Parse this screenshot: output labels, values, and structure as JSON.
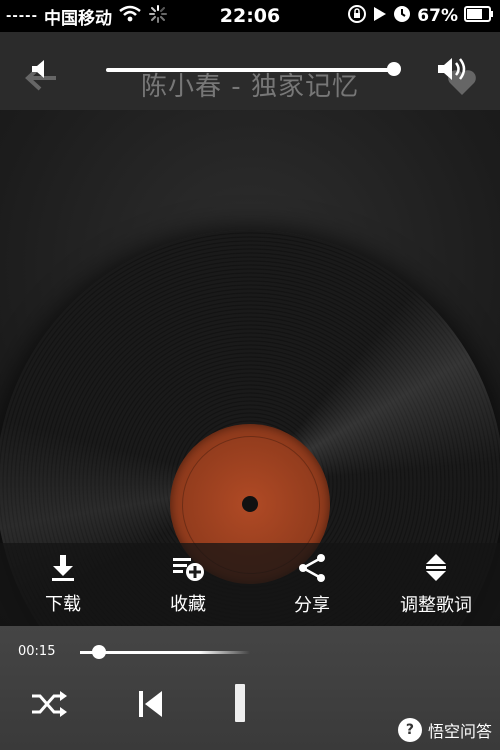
{
  "status_bar": {
    "signal": "-----",
    "carrier": "中国移动",
    "time": "22:06",
    "battery": "67%"
  },
  "player": {
    "song_title": "陈小春 - 独家记忆",
    "volume_fraction": 0.92,
    "elapsed": "00:15",
    "progress_fraction": 0.08
  },
  "actions": {
    "download": "下载",
    "favorite": "收藏",
    "share": "分享",
    "adjust_lyrics": "调整歌词"
  },
  "watermark": {
    "text": "悟空问答"
  },
  "icons": {
    "back": "back-arrow-icon",
    "volume_low": "volume-low-icon",
    "volume_high": "volume-high-icon",
    "like": "heart-icon",
    "download": "download-icon",
    "favorite": "playlist-add-icon",
    "share": "share-icon",
    "adjust": "updown-icon",
    "shuffle": "shuffle-icon",
    "prev": "skip-previous-icon",
    "pause": "pause-icon"
  },
  "colors": {
    "label": "#b04a25",
    "background": "#1a1a1a"
  }
}
